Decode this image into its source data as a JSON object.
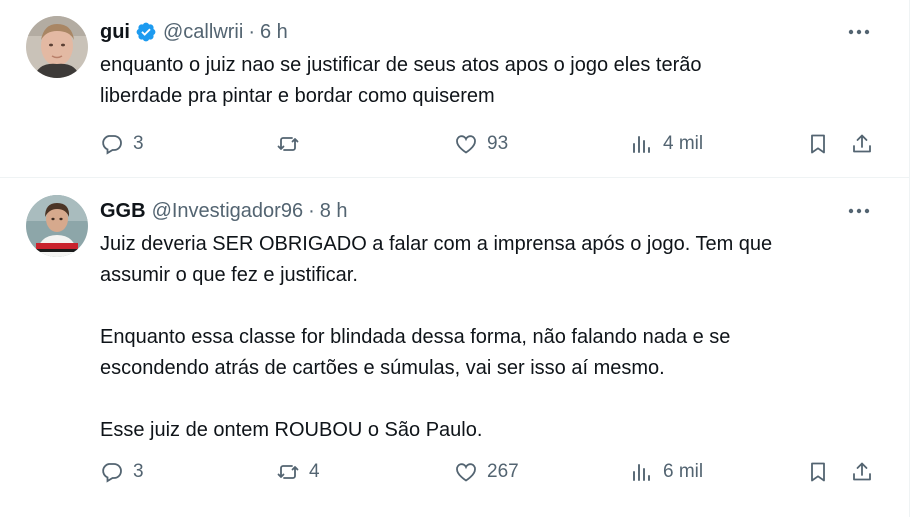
{
  "tweets": [
    {
      "name": "gui",
      "verified": true,
      "handle": "@callwrii",
      "separator": "·",
      "time": "6 h",
      "text": "enquanto o juiz nao se justificar de seus atos apos o jogo eles terão\nliberdade pra pintar e bordar como quiserem",
      "replies": "3",
      "retweets": "",
      "likes": "93",
      "views": "4 mil"
    },
    {
      "name": "GGB",
      "verified": false,
      "handle": "@Investigador96",
      "separator": "·",
      "time": "8 h",
      "text": "Juiz deveria SER OBRIGADO a falar com a imprensa após o jogo. Tem que\nassumir o que fez e justificar.\n\nEnquanto essa classe for blindada dessa forma, não falando nada e se\nescondendo atrás de cartões e súmulas, vai ser isso aí mesmo.\n\nEsse juiz de ontem ROUBOU o São Paulo.",
      "replies": "3",
      "retweets": "4",
      "likes": "267",
      "views": "6 mil"
    }
  ],
  "colors": {
    "muted": "#536471",
    "text": "#0f1419",
    "verified": "#1d9bf0",
    "divider": "#eff3f4"
  },
  "icons": [
    "verified-badge-icon",
    "more-icon",
    "reply-icon",
    "retweet-icon",
    "like-icon",
    "views-icon",
    "bookmark-icon",
    "share-icon"
  ]
}
